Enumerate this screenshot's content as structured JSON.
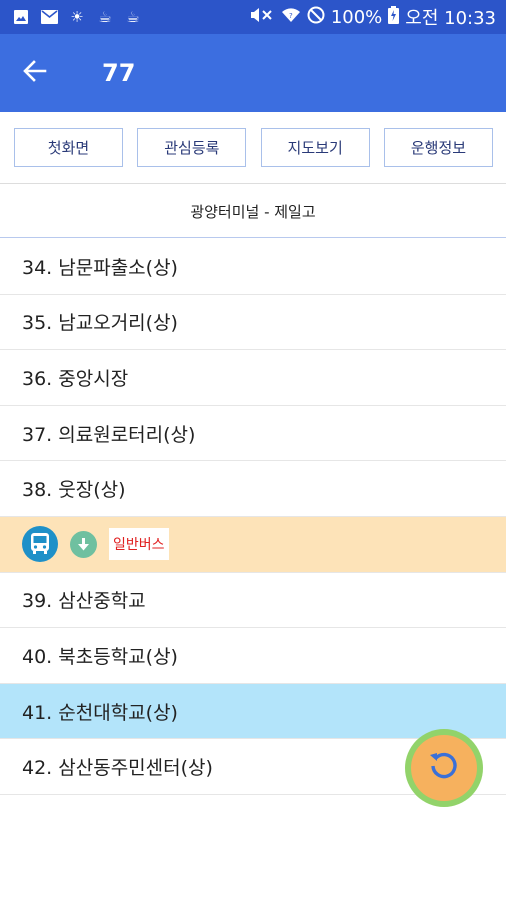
{
  "status_bar": {
    "battery": "100%",
    "time": "오전 10:33",
    "icons": [
      "image-icon",
      "mail-icon",
      "sun-icon",
      "cup-icon",
      "cup-icon",
      "mute-icon",
      "wifi-icon",
      "dnd-icon",
      "battery-charging-icon"
    ]
  },
  "app_bar": {
    "title": "77",
    "back_icon": "arrow-back-icon"
  },
  "toolbar": {
    "home_label": "첫화면",
    "favorite_label": "관심등록",
    "map_label": "지도보기",
    "info_label": "운행정보"
  },
  "route": {
    "name": "광양터미널 - 제일고"
  },
  "stops": [
    {
      "label": "34. 남문파출소(상)"
    },
    {
      "label": "35. 남교오거리(상)"
    },
    {
      "label": "36. 중앙시장"
    },
    {
      "label": "37. 의료원로터리(상)"
    },
    {
      "label": "38. 웃장(상)"
    },
    {
      "label": "39. 삼산중학교"
    },
    {
      "label": "40. 북초등학교(상)"
    },
    {
      "label": "41. 순천대학교(상)"
    },
    {
      "label": "42. 삼산동주민센터(상)"
    }
  ],
  "bus_marker": {
    "badge": "일반버스",
    "icon": "bus-icon",
    "direction_icon": "arrow-down-icon"
  },
  "fab": {
    "icon": "refresh-icon"
  },
  "colors": {
    "status_bar": "#2c55c9",
    "app_bar": "#3c6ee0",
    "bus_row": "#fde3b8",
    "selected_row": "#b3e4fa",
    "badge_text": "#e02020"
  }
}
